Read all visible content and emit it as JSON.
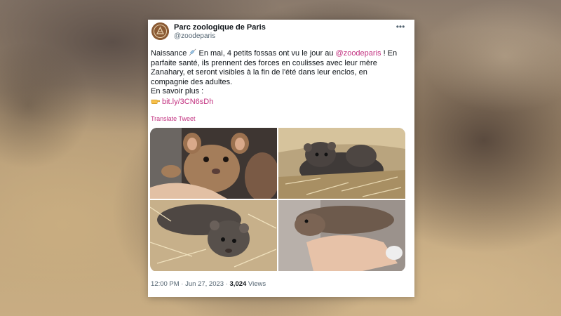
{
  "tweet": {
    "display_name": "Parc zoologique de Paris",
    "handle": "@zoodeparis",
    "more_icon": "more-horizontal-icon",
    "body": {
      "line1_prefix": "Naissance ",
      "line1_mid": " En mai, 4 petits fossas ont vu le jour au ",
      "mention": "@zoodeparis",
      "line1_suffix": " ! En parfaite santé, ils prennent des forces en coulisses avec leur mère Zanahary, et seront visibles à la fin de l'été dans leur enclos, en compagnie des adultes.",
      "more_label": "En savoir plus :",
      "link": "bit.ly/3CN6sDh"
    },
    "translate_label": "Translate Tweet",
    "photos": [
      {
        "subject": "fossa cub held in hands"
      },
      {
        "subject": "two fossa cubs on straw"
      },
      {
        "subject": "fossa cub lying on straw"
      },
      {
        "subject": "fossa cub held in hand"
      }
    ],
    "time": "12:00 PM",
    "separator": " · ",
    "date": "Jun 27, 2023",
    "views_count": "3,024",
    "views_label": " Views"
  },
  "colors": {
    "link": "#c2307f",
    "text": "#0f1419",
    "muted": "#536471"
  }
}
